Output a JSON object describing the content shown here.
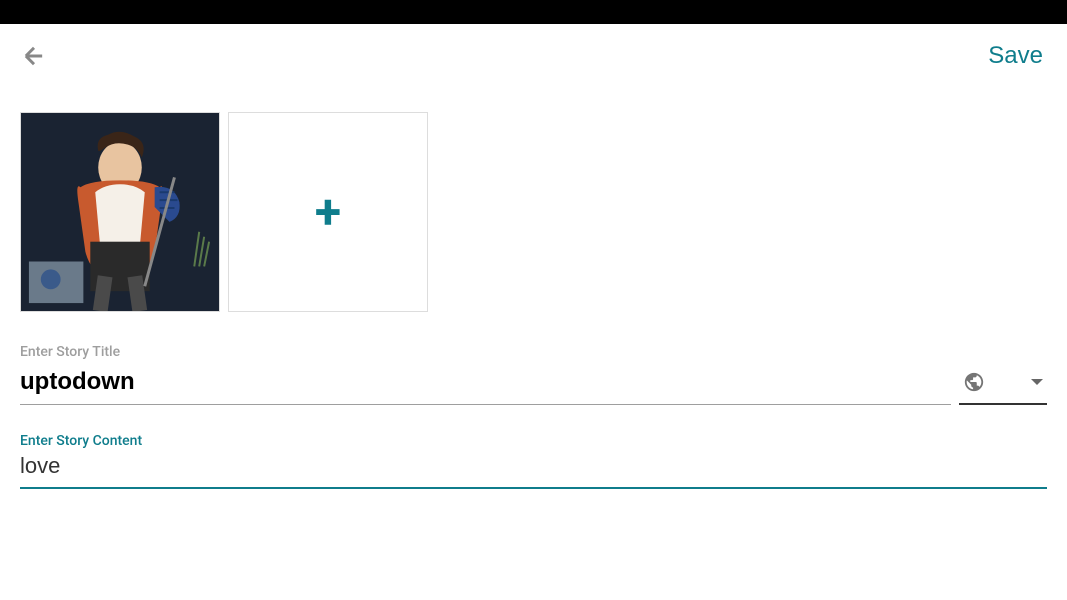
{
  "header": {
    "save_label": "Save"
  },
  "title_field": {
    "label": "Enter Story Title",
    "value": "uptodown"
  },
  "content_field": {
    "label": "Enter Story Content",
    "value": "love"
  },
  "privacy": {
    "option": "public"
  },
  "icons": {
    "back": "back-arrow",
    "add": "+",
    "globe": "globe"
  }
}
